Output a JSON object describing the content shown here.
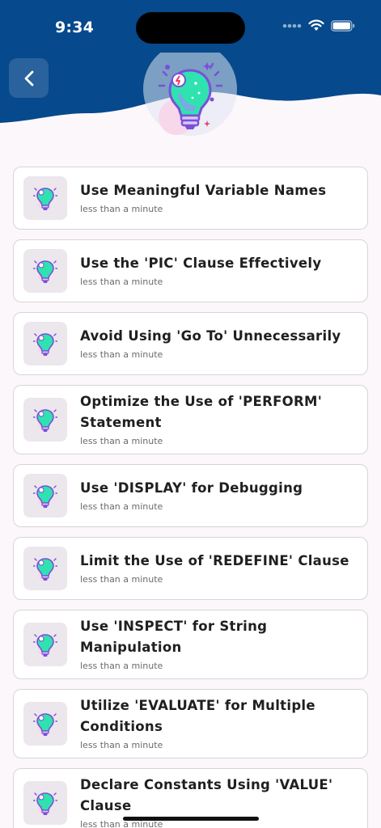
{
  "status_bar": {
    "time": "9:34"
  },
  "colors": {
    "header": "#06498c",
    "background": "#fcf7fb",
    "accent_green": "#21d3a0",
    "accent_purple": "#7b4fd8"
  },
  "icons": {
    "back": "chevron-left-icon",
    "hero": "lightbulb-icon",
    "item": "lightbulb-icon"
  },
  "items": [
    {
      "title": "Use Meaningful Variable Names",
      "duration": "less than a minute"
    },
    {
      "title": "Use the 'PIC' Clause Effectively",
      "duration": "less than a minute"
    },
    {
      "title": "Avoid Using 'Go To' Unnecessarily",
      "duration": "less than a minute"
    },
    {
      "title": "Optimize the Use of 'PERFORM' Statement",
      "duration": "less than a minute"
    },
    {
      "title": "Use 'DISPLAY' for Debugging",
      "duration": "less than a minute"
    },
    {
      "title": "Limit the Use of 'REDEFINE' Clause",
      "duration": "less than a minute"
    },
    {
      "title": "Use 'INSPECT' for String Manipulation",
      "duration": "less than a minute"
    },
    {
      "title": "Utilize 'EVALUATE' for Multiple Conditions",
      "duration": "less than a minute"
    },
    {
      "title": "Declare Constants Using 'VALUE' Clause",
      "duration": "less than a minute"
    }
  ]
}
